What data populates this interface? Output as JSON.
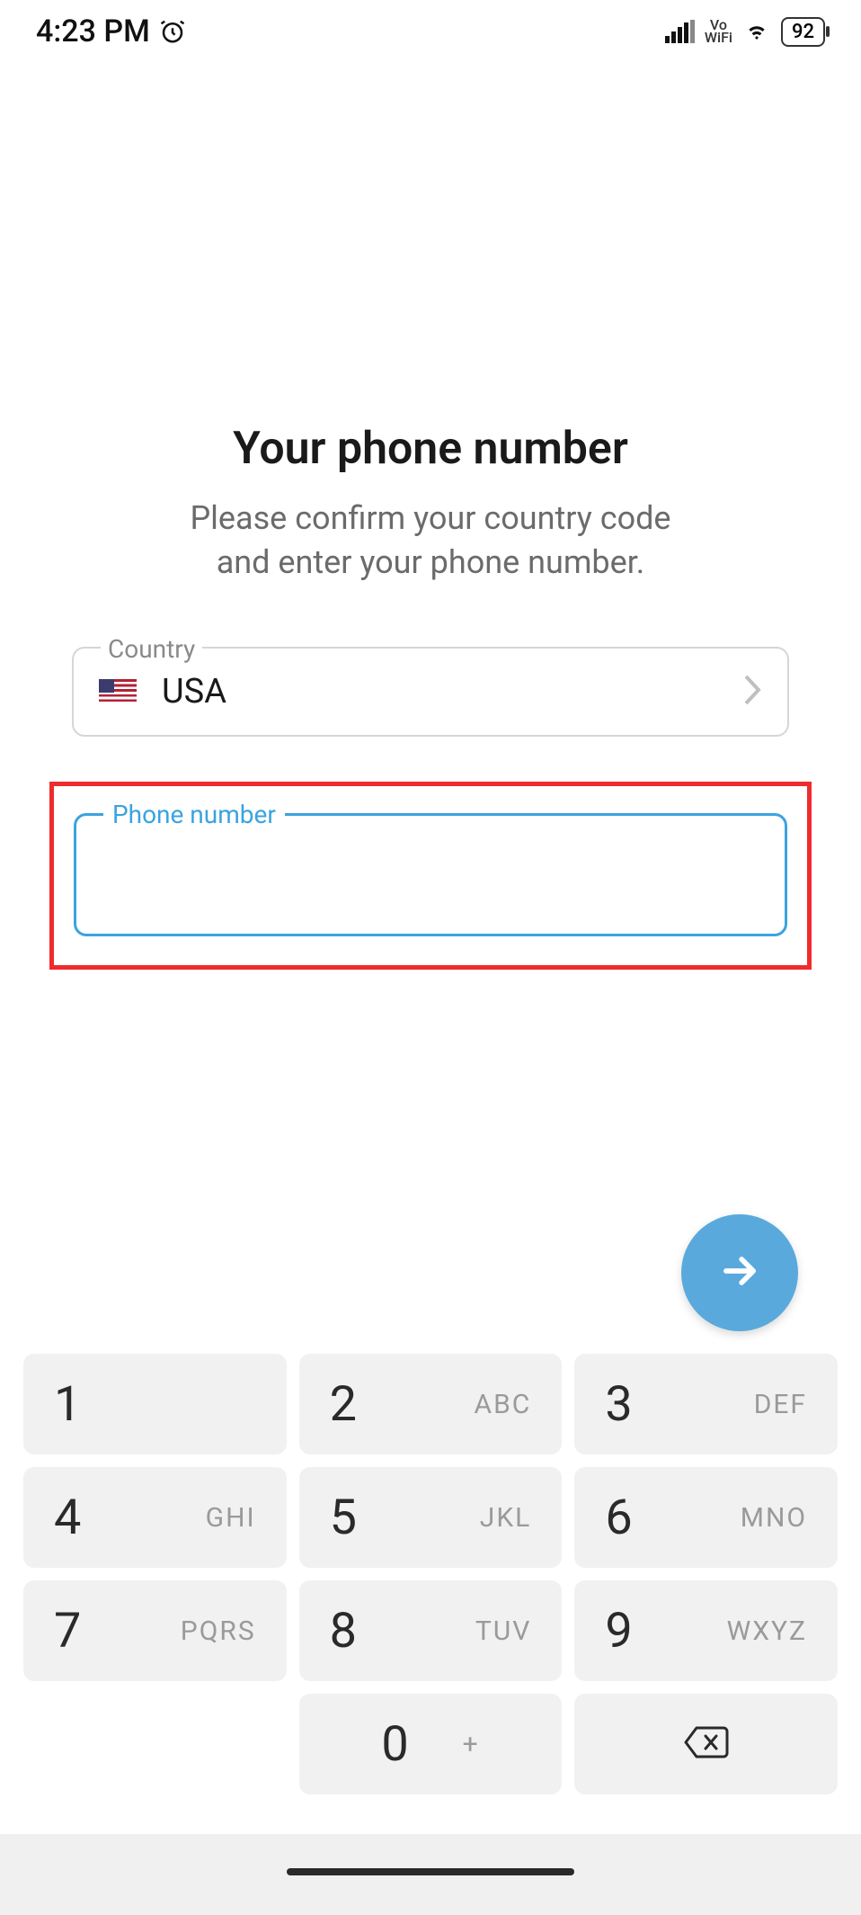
{
  "status": {
    "time": "4:23 PM",
    "alarm_icon": "alarm-icon",
    "vo_top": "Vo",
    "vo_bottom": "WiFi",
    "battery": "92"
  },
  "heading": "Your phone number",
  "subheading_line1": "Please confirm your country code",
  "subheading_line2": "and enter your phone number.",
  "country_field": {
    "label": "Country",
    "value": "USA"
  },
  "phone_field": {
    "label": "Phone number",
    "value": ""
  },
  "keypad": {
    "keys": [
      {
        "digit": "1",
        "letters": ""
      },
      {
        "digit": "2",
        "letters": "ABC"
      },
      {
        "digit": "3",
        "letters": "DEF"
      },
      {
        "digit": "4",
        "letters": "GHI"
      },
      {
        "digit": "5",
        "letters": "JKL"
      },
      {
        "digit": "6",
        "letters": "MNO"
      },
      {
        "digit": "7",
        "letters": "PQRS"
      },
      {
        "digit": "8",
        "letters": "TUV"
      },
      {
        "digit": "9",
        "letters": "WXYZ"
      },
      {
        "digit": "0",
        "letters": "+"
      }
    ]
  }
}
